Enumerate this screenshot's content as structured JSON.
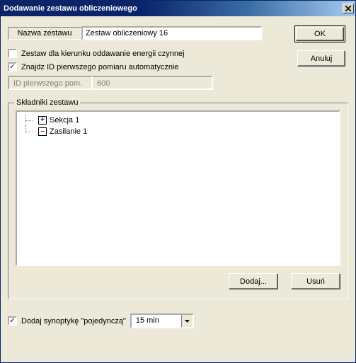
{
  "window": {
    "title": "Dodawanie zestawu obliczeniowego"
  },
  "buttons": {
    "ok": "OK",
    "cancel": "Anuluj",
    "add": "Dodaj...",
    "delete": "Usuń"
  },
  "name": {
    "label": "Nazwa zestawu",
    "value": "Zestaw obliczeniowy 16"
  },
  "options": {
    "direction_checked": false,
    "direction_label": "Zestaw dla kierunku oddawanie energii czynnej",
    "autoid_checked": true,
    "autoid_label": "Znajdz ID pierwszego pomiaru automatycznie"
  },
  "first_id": {
    "label": "ID pierwszego pom.",
    "value": "600"
  },
  "group": {
    "legend": "Składniki zestawu",
    "items": [
      {
        "icon": "plus",
        "label": "Sekcja 1"
      },
      {
        "icon": "minus",
        "label": "Zasilanie 1"
      }
    ]
  },
  "synoptic": {
    "checked": true,
    "label": "Dodaj synoptykę \"pojedynczą\"",
    "interval": "15 min"
  }
}
